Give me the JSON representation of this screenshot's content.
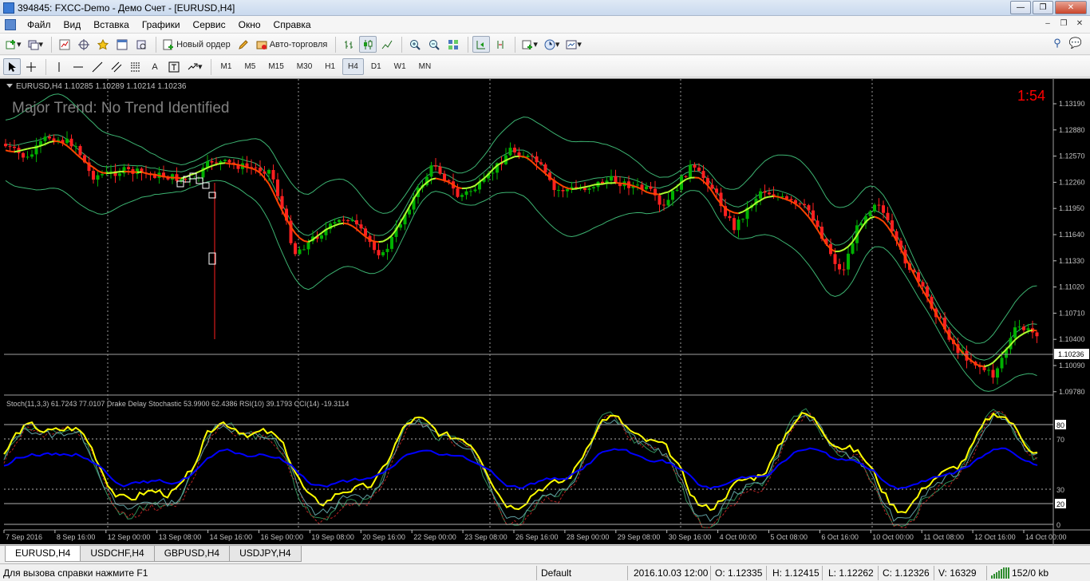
{
  "window": {
    "title": "394845: FXCC-Demo - Демо Счет - [EURUSD,H4]"
  },
  "menu": [
    "Файл",
    "Вид",
    "Вставка",
    "Графики",
    "Сервис",
    "Окно",
    "Справка"
  ],
  "toolbar": {
    "new_order": "Новый ордер",
    "auto_trading": "Авто-торговля",
    "timeframes": [
      "M1",
      "M5",
      "M15",
      "M30",
      "H1",
      "H4",
      "D1",
      "W1",
      "MN"
    ],
    "active_timeframe": "H4"
  },
  "chart": {
    "header": "EURUSD,H4  1.10285 1.10289 1.10214 1.10236",
    "trend_text": "Major Trend: No Trend Identified",
    "timer": "1:54",
    "current_price": "1.10236",
    "price_ticks": [
      "1.13190",
      "1.12880",
      "1.12570",
      "1.12260",
      "1.11950",
      "1.11640",
      "1.11330",
      "1.11020",
      "1.10710",
      "1.10400",
      "1.10090",
      "1.09780"
    ],
    "indicator_header": "Stoch(11,3,3) 61.7243 77.0107  Drake Delay Stochastic 53.9900 62.4386  RSI(10) 39.1793  CCI(14) -19.3114",
    "indicator_ticks": [
      "80",
      "70",
      "30",
      "20",
      "0"
    ],
    "time_ticks": [
      "7 Sep 2016",
      "8 Sep 16:00",
      "12 Sep 00:00",
      "13 Sep 08:00",
      "14 Sep 16:00",
      "16 Sep 00:00",
      "19 Sep 08:00",
      "20 Sep 16:00",
      "22 Sep 00:00",
      "23 Sep 08:00",
      "26 Sep 16:00",
      "28 Sep 00:00",
      "29 Sep 08:00",
      "30 Sep 16:00",
      "4 Oct 00:00",
      "5 Oct 08:00",
      "6 Oct 16:00",
      "10 Oct 00:00",
      "11 Oct 08:00",
      "12 Oct 16:00",
      "14 Oct 00:00"
    ],
    "colors": {
      "bull": "#00b000",
      "bear": "#ff2020",
      "ma_up": "#adff2f",
      "ma_down": "#ff4500",
      "band": "#3cb371",
      "stoch_yellow": "#ffff00",
      "rsi_blue": "#0000ff",
      "timer": "#ff0000",
      "trend_text": "#808080"
    }
  },
  "tabs": [
    "EURUSD,H4",
    "USDCHF,H4",
    "GBPUSD,H4",
    "USDJPY,H4"
  ],
  "active_tab": "EURUSD,H4",
  "status": {
    "help": "Для вызова справки нажмите F1",
    "profile": "Default",
    "datetime": "2016.10.03 12:00",
    "open": "O: 1.12335",
    "high": "H: 1.12415",
    "low": "L: 1.12262",
    "close": "C: 1.12326",
    "volume": "V: 16329",
    "traffic": "152/0 kb"
  }
}
